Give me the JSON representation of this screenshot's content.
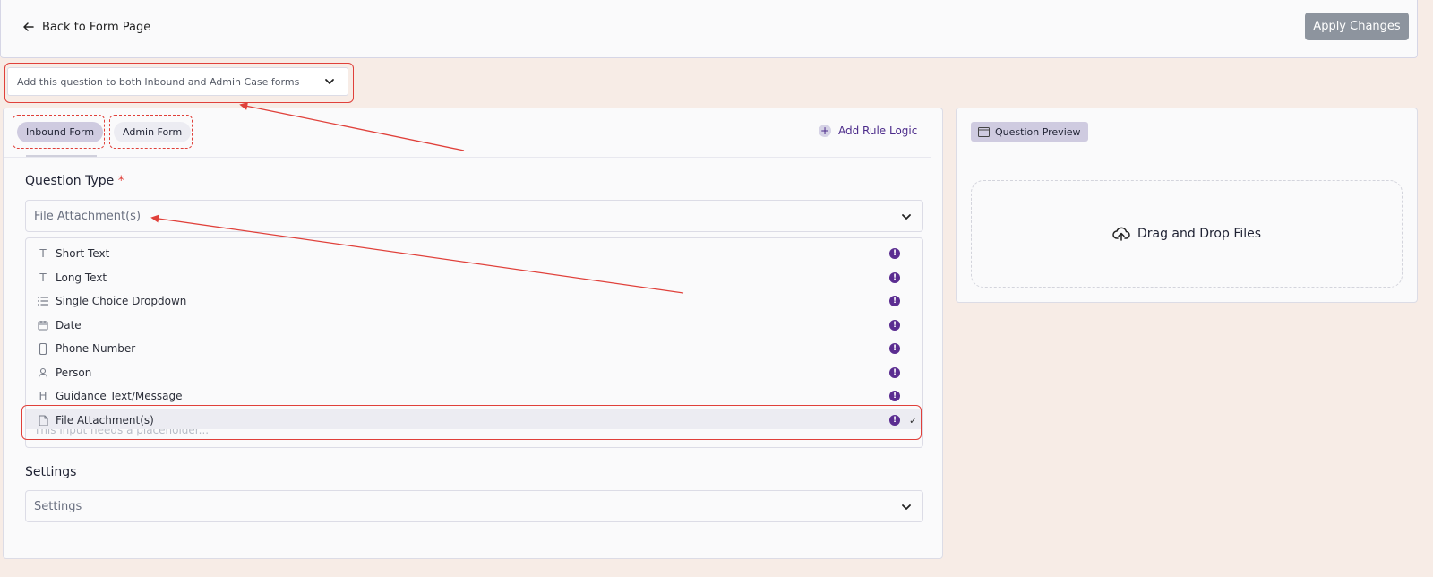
{
  "header": {
    "back_label": "Back to Form Page",
    "apply_label": "Apply Changes"
  },
  "scope_select": {
    "value": "Add this question to both Inbound and Admin Case forms"
  },
  "tabs": [
    {
      "label": "Inbound Form"
    },
    {
      "label": "Admin Form"
    }
  ],
  "rule_logic_label": "Add Rule Logic",
  "question_type": {
    "label": "Question Type",
    "required_mark": "*",
    "value": "File Attachment(s)",
    "options": [
      {
        "label": "Short Text",
        "icon": "text-icon"
      },
      {
        "label": "Long Text",
        "icon": "text-icon"
      },
      {
        "label": "Single Choice Dropdown",
        "icon": "list-icon"
      },
      {
        "label": "Date",
        "icon": "calendar-icon"
      },
      {
        "label": "Phone Number",
        "icon": "phone-icon"
      },
      {
        "label": "Person",
        "icon": "person-icon"
      },
      {
        "label": "Guidance Text/Message",
        "icon": "heading-icon"
      },
      {
        "label": "File Attachment(s)",
        "icon": "file-icon",
        "selected": true
      }
    ],
    "check_mark": "✓",
    "info_mark": "!"
  },
  "placeholder_field": {
    "placeholder": "This input needs a placeholder..."
  },
  "settings": {
    "label": "Settings",
    "value": "Settings"
  },
  "preview": {
    "badge_label": "Question Preview",
    "dropzone_label": "Drag and Drop Files"
  },
  "colors": {
    "accent": "#4b2a8a",
    "info_badge": "#5b2d91",
    "annotation": "#e0403a",
    "background": "#f7ece6"
  }
}
